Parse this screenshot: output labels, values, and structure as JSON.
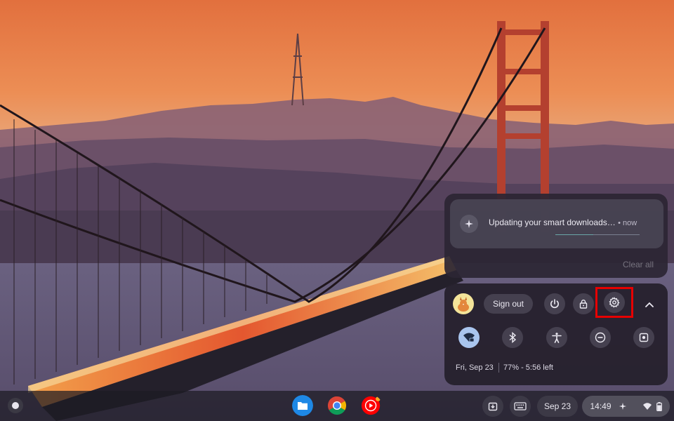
{
  "notification": {
    "title": "Updating your smart downloads…",
    "time": "• now",
    "progress": 0.45,
    "clear_all": "Clear all",
    "icon": "sparkle-icon"
  },
  "quick_settings": {
    "sign_out": "Sign out",
    "buttons": [
      "power-icon",
      "lock-icon",
      "settings-gear-icon",
      "chevron-up-icon"
    ],
    "tiles": [
      "wifi-icon",
      "bluetooth-icon",
      "accessibility-icon",
      "do-not-disturb-icon",
      "screen-capture-icon"
    ],
    "date": "Fri, Sep 23",
    "battery": "77% - 5:56 left"
  },
  "shelf": {
    "apps": [
      "files-app",
      "chrome-app",
      "youtube-music-app"
    ],
    "date": "Sep 23",
    "time": "14:49"
  },
  "colors": {
    "accent_tile": "#a9c5ee",
    "highlight": "#e60000"
  }
}
